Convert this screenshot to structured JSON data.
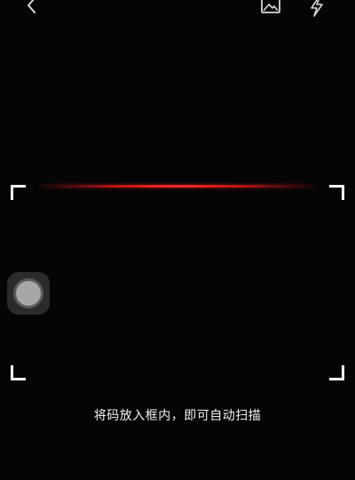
{
  "top_bar": {
    "back_icon": "chevron-left-icon",
    "gallery_icon": "image-icon",
    "flash_icon": "lightning-icon"
  },
  "scanner": {
    "hint": "将码放入框内，即可自动扫描"
  },
  "colors": {
    "background": "#050505",
    "scan_line": "#ff2a2a",
    "frame_corners": "#ffffff",
    "text": "#f2f2f2"
  }
}
